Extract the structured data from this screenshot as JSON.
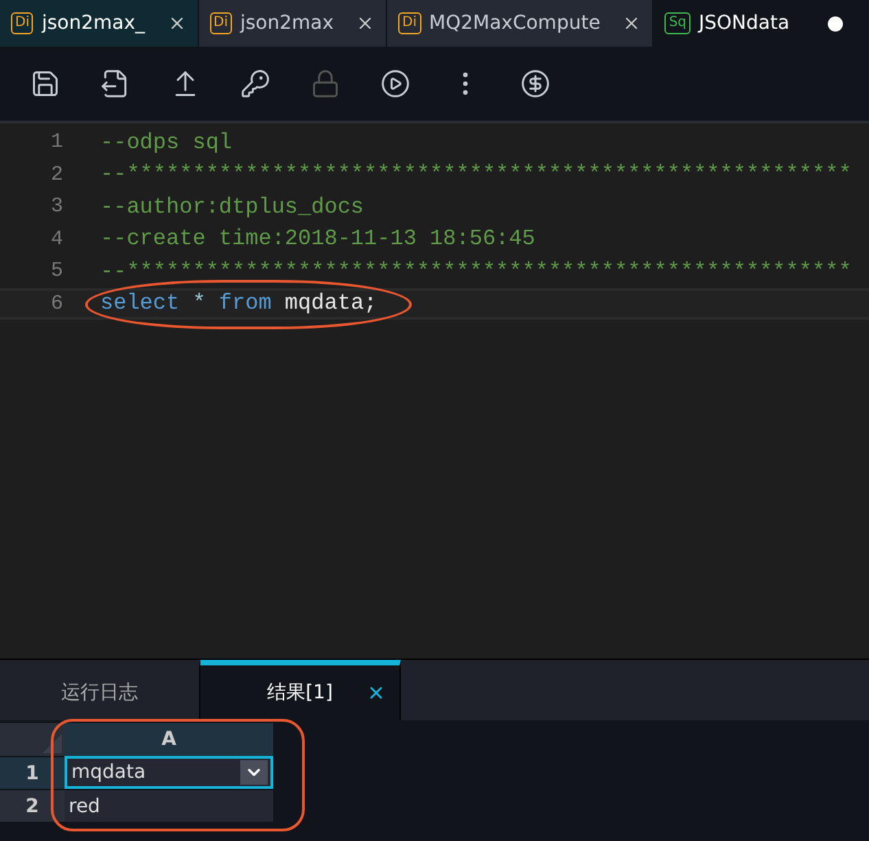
{
  "file_tabs": [
    {
      "badge": "Di",
      "color": "#f5a623",
      "label": "json2max_",
      "selected": true,
      "modified": false
    },
    {
      "badge": "Di",
      "color": "#f5a623",
      "label": "json2max",
      "selected": false,
      "modified": false
    },
    {
      "badge": "Di",
      "color": "#f5a623",
      "label": "MQ2MaxCompute",
      "selected": false,
      "modified": false
    },
    {
      "badge": "Sq",
      "color": "#3fb950",
      "label": "JSONdata",
      "selected": false,
      "modified": true
    }
  ],
  "toolbar": [
    {
      "kind": "save",
      "disabled": false
    },
    {
      "kind": "save-as",
      "disabled": false
    },
    {
      "kind": "upload",
      "disabled": false
    },
    {
      "kind": "key",
      "disabled": false
    },
    {
      "kind": "lock",
      "disabled": true
    },
    {
      "kind": "run",
      "disabled": false
    },
    {
      "kind": "more",
      "disabled": false
    },
    {
      "kind": "cost",
      "disabled": false
    }
  ],
  "editor": {
    "lines": [
      {
        "number": "1",
        "tokens": [
          {
            "kind": "comment",
            "text": "--odps sql"
          }
        ]
      },
      {
        "number": "2",
        "tokens": [
          {
            "kind": "comment",
            "text": "--*******************************************************"
          }
        ]
      },
      {
        "number": "3",
        "tokens": [
          {
            "kind": "comment",
            "text": "--author:dtplus_docs"
          }
        ]
      },
      {
        "number": "4",
        "tokens": [
          {
            "kind": "comment",
            "text": "--create time:2018-11-13 18:56:45"
          }
        ]
      },
      {
        "number": "5",
        "tokens": [
          {
            "kind": "comment",
            "text": "--*******************************************************"
          }
        ]
      },
      {
        "number": "6",
        "current": true,
        "highlighted": true,
        "tokens": [
          {
            "kind": "keyword",
            "text": "select"
          },
          {
            "kind": "operator",
            "text": " * "
          },
          {
            "kind": "keyword",
            "text": "from"
          },
          {
            "kind": "plain",
            "text": " mqdata;"
          }
        ]
      }
    ]
  },
  "result_tabs": [
    {
      "label": "运行日志",
      "selected": false,
      "closable": false
    },
    {
      "label": "结果[1]",
      "selected": true,
      "closable": true
    }
  ],
  "result_grid": {
    "columns": [
      "A"
    ],
    "highlighted": true,
    "rows": [
      {
        "number": "1",
        "cells": [
          {
            "text": "mqdata",
            "selected": true
          }
        ]
      },
      {
        "number": "2",
        "cells": [
          {
            "text": "red",
            "selected": false
          }
        ]
      }
    ]
  }
}
